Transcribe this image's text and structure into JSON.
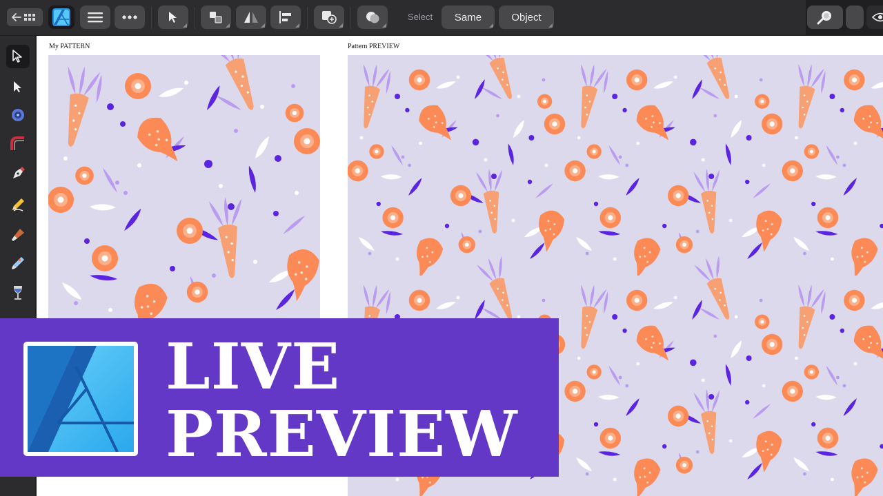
{
  "toolbar": {
    "select_label": "Select",
    "same_label": "Same",
    "object_label": "Object"
  },
  "canvas": {
    "pattern_title": "My PATTERN",
    "preview_title": "Pattern PREVIEW"
  },
  "banner": {
    "line1": "LIVE",
    "line2": "PREVIEW"
  },
  "colors": {
    "background": "#ddd9ec",
    "orange": "#fb8a56",
    "carrot": "#f7a074",
    "violet": "#5a24e0",
    "lavender": "#b99bef",
    "banner": "#6438c6",
    "logo_blue": "#45c3f4"
  },
  "icons": {
    "back": "back-arrow-grid-icon",
    "app": "affinity-designer-icon",
    "menu": "hamburger-menu-icon",
    "more": "more-options-icon",
    "move": "move-tool-icon",
    "arrange": "arrange-icon",
    "flip": "flip-icon",
    "align": "align-icon",
    "insert": "insert-object-icon",
    "boolean": "boolean-operations-icon",
    "zoom": "zoom-icon",
    "view": "view-mode-icon"
  }
}
